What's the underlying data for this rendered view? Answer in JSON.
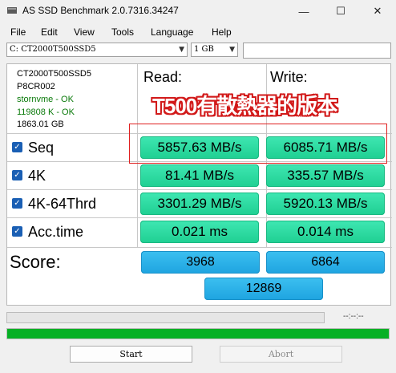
{
  "window": {
    "title": "AS SSD Benchmark 2.0.7316.34247",
    "minimize_glyph": "—",
    "maximize_glyph": "☐",
    "close_glyph": "✕"
  },
  "menu": [
    "File",
    "Edit",
    "View",
    "Tools",
    "Language",
    "Help"
  ],
  "selectors": {
    "drive": "C: CT2000T500SSD5",
    "size": "1 GB"
  },
  "drive_info": {
    "model": "CT2000T500SSD5",
    "firmware": "P8CR002",
    "driver": "stornvme - OK",
    "alignment": "119808 K - OK",
    "capacity": "1863.01 GB"
  },
  "columns": {
    "read": "Read:",
    "write": "Write:"
  },
  "tests": [
    {
      "name": "Seq",
      "read": "5857.63 MB/s",
      "write": "6085.71 MB/s",
      "checked": true
    },
    {
      "name": "4K",
      "read": "81.41 MB/s",
      "write": "335.57 MB/s",
      "checked": true
    },
    {
      "name": "4K-64Thrd",
      "read": "3301.29 MB/s",
      "write": "5920.13 MB/s",
      "checked": true
    },
    {
      "name": "Acc.time",
      "read": "0.021 ms",
      "write": "0.014 ms",
      "checked": true
    }
  ],
  "score": {
    "label": "Score:",
    "read": "3968",
    "write": "6864",
    "total": "12869"
  },
  "overlay_text": "T500有散熱器的版本",
  "status": {
    "elapsed": "--:--:--",
    "progress_top": 0,
    "progress_bottom": 1.0
  },
  "buttons": {
    "start": "Start",
    "abort": "Abort"
  },
  "colors": {
    "result_green": "#2bdca0",
    "score_blue": "#2bb3ea",
    "progress_green": "#06b025",
    "annotation_red": "#e02020"
  }
}
